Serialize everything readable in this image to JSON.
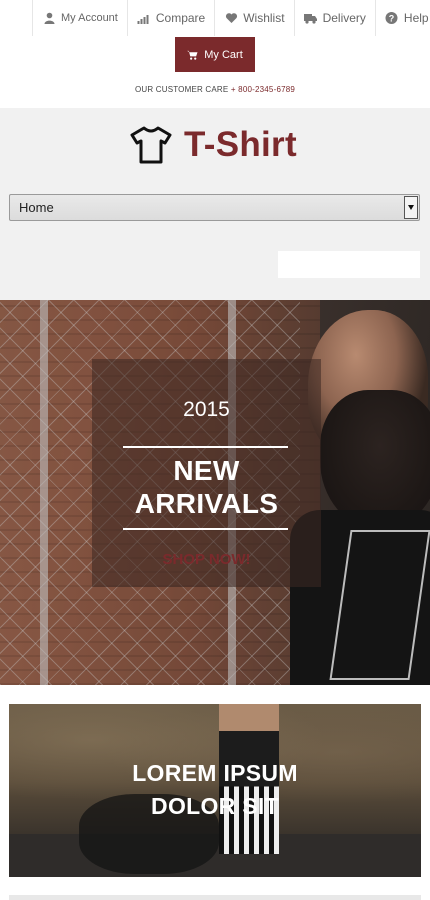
{
  "top_links": [
    {
      "label": "My Account",
      "icon": "user-icon"
    },
    {
      "label": "Compare",
      "icon": "bar-chart-icon"
    },
    {
      "label": "Wishlist",
      "icon": "heart-icon"
    },
    {
      "label": "Delivery",
      "icon": "truck-icon"
    },
    {
      "label": "Help",
      "icon": "question-icon"
    }
  ],
  "cart": {
    "label": "My Cart",
    "icon": "cart-icon"
  },
  "customer_care": {
    "text": "OUR CUSTOMER CARE",
    "phone": "+ 800-2345-6789"
  },
  "logo": {
    "text": "T-Shirt",
    "icon": "tshirt-icon"
  },
  "nav": {
    "selected": "Home"
  },
  "search": {
    "value": "",
    "placeholder": "",
    "icon": "search-icon"
  },
  "hero": {
    "year": "2015",
    "title_line1": "NEW",
    "title_line2": "ARRIVALS",
    "cta": "SHOP NOW!"
  },
  "banner2": {
    "title_line1": "LOREM IPSUM",
    "title_line2": "DOLOR SIT"
  },
  "colors": {
    "accent": "#7b2a2c",
    "header_bg": "#f1f1f1"
  }
}
